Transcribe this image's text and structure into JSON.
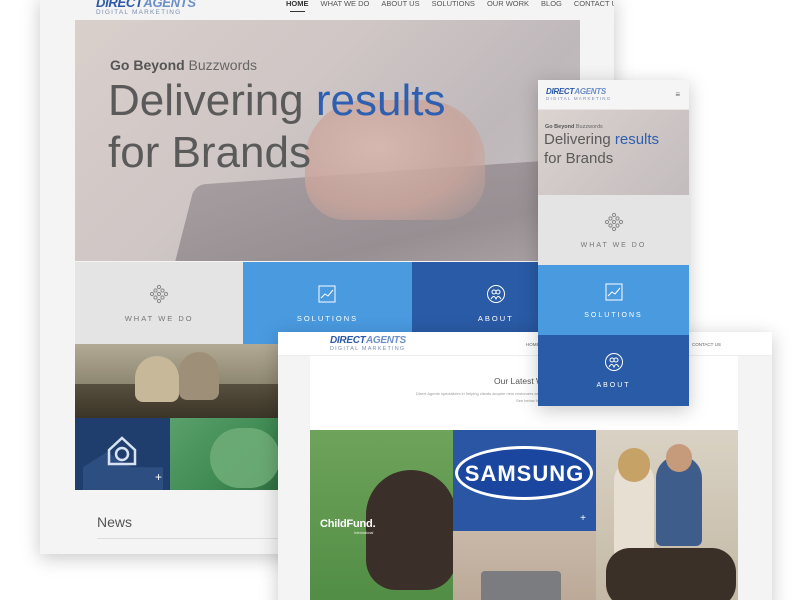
{
  "brand": {
    "name_part1": "DIRECT",
    "name_part2": "AGENTS",
    "tagline": "DIGITAL MARKETING"
  },
  "desktop": {
    "nav": [
      {
        "label": "HOME",
        "active": true
      },
      {
        "label": "WHAT WE DO",
        "active": false
      },
      {
        "label": "ABOUT US",
        "active": false
      },
      {
        "label": "SOLUTIONS",
        "active": false
      },
      {
        "label": "OUR WORK",
        "active": false
      },
      {
        "label": "BLOG",
        "active": false
      },
      {
        "label": "CONTACT US",
        "active": false
      }
    ],
    "hero": {
      "tagline_bold": "Go Beyond",
      "tagline_rest": " Buzzwords",
      "headline_l1_a": "Delivering ",
      "headline_l1_b": "results",
      "headline_l2": "for Brands"
    },
    "tiles": [
      {
        "label": "WHAT WE DO",
        "icon": "diamond-dots-icon"
      },
      {
        "label": "SOLUTIONS",
        "icon": "chart-icon"
      },
      {
        "label": "ABOUT",
        "icon": "people-icon"
      }
    ],
    "news_title": "News"
  },
  "tablet": {
    "nav_home": "HOME",
    "nav_contact": "CONTACT US",
    "section_title": "Our Latest W",
    "desc_line1": "Direct Agents specializes in helping clients acquire new customers and generat",
    "desc_line2": "See below for some of our",
    "childfund_logo": "ChildFund.",
    "childfund_sub": "International",
    "samsung": "SAMSUNG"
  },
  "mobile": {
    "menu_icon": "hamburger-icon",
    "hero": {
      "tagline_bold": "Go Beyond",
      "tagline_rest": " Buzzwords",
      "headline_l1_a": "Delivering ",
      "headline_l1_b": "results",
      "headline_l2": "for Brands"
    },
    "tiles": [
      {
        "label": "WHAT WE DO"
      },
      {
        "label": "SOLUTIONS"
      },
      {
        "label": "ABOUT"
      }
    ]
  },
  "colors": {
    "brand_blue": "#2b59a8",
    "tile_blue": "#4a9ae0",
    "tile_navy": "#2a5ba6",
    "tile_gray": "#e4e4e4",
    "accent_text": "#2e5fb0"
  }
}
